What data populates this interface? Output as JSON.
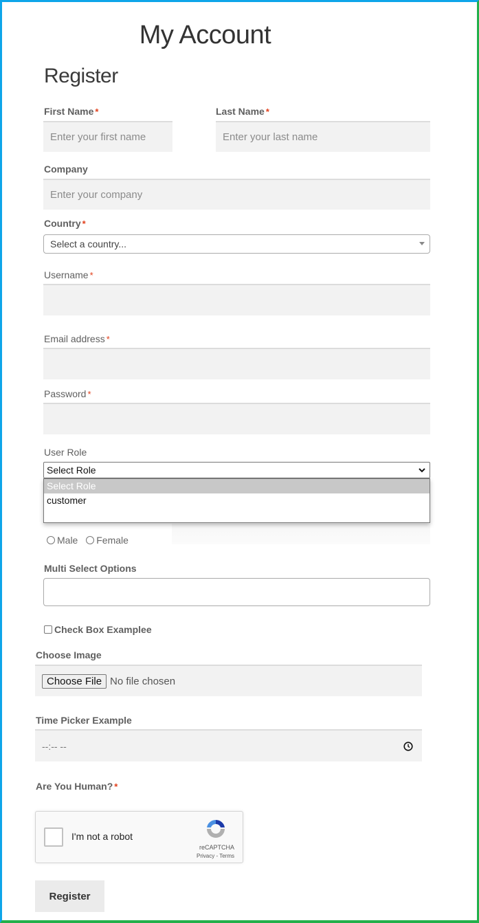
{
  "page": {
    "title": "My Account",
    "subtitle": "Register",
    "colors": {
      "frame_top_left": "#0ea5e9",
      "frame_bottom_right": "#22b04b",
      "required": "#e2401c"
    }
  },
  "form": {
    "first_name": {
      "label": "First Name",
      "required": "*",
      "placeholder": "Enter your first name",
      "value": ""
    },
    "last_name": {
      "label": "Last Name",
      "required": "*",
      "placeholder": "Enter your last name",
      "value": ""
    },
    "company": {
      "label": "Company",
      "placeholder": "Enter your company",
      "value": ""
    },
    "country": {
      "label": "Country",
      "required": "*",
      "selected": "Select a country..."
    },
    "username": {
      "label": "Username",
      "required": "*",
      "value": ""
    },
    "email": {
      "label": "Email address",
      "required": "*",
      "value": ""
    },
    "password": {
      "label": "Password",
      "required": "*",
      "value": ""
    },
    "user_role": {
      "label": "User Role",
      "selected": "Select Role",
      "options": [
        "Select Role",
        "customer"
      ],
      "highlighted_index": 0
    },
    "gender": {
      "options": [
        "Male",
        "Female"
      ],
      "selected": null
    },
    "multi_select": {
      "label": "Multi Select Options",
      "values": []
    },
    "checkbox": {
      "label": "Check Box Examplee",
      "checked": false
    },
    "image": {
      "label": "Choose Image",
      "button": "Choose File",
      "status": "No file chosen"
    },
    "time": {
      "label": "Time Picker Example",
      "value": "--:-- --"
    },
    "captcha": {
      "label": "Are You Human?",
      "required": "*",
      "text": "I'm not a robot",
      "brand": "reCAPTCHA",
      "links": "Privacy - Terms"
    },
    "submit": "Register"
  }
}
